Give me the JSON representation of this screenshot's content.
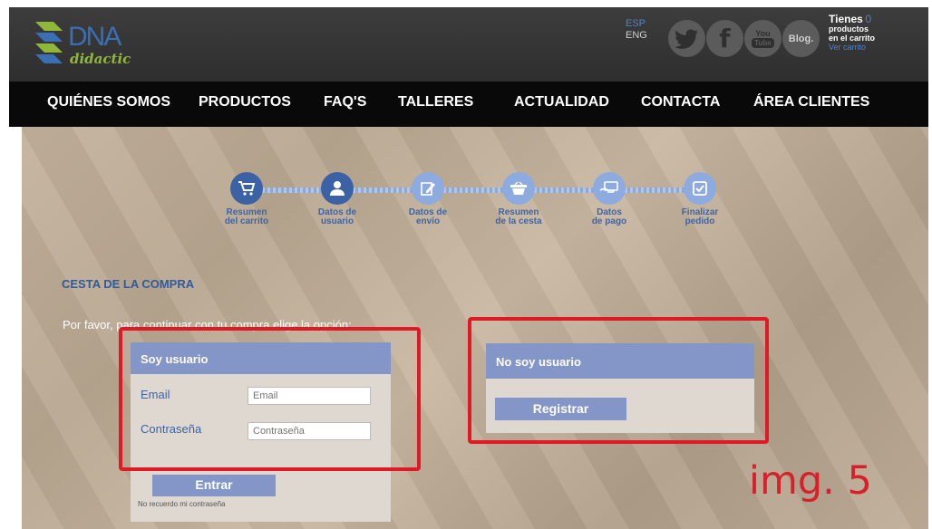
{
  "brand": {
    "name": "DNA",
    "sub": "didactic"
  },
  "languages": {
    "active": "ESP",
    "other": "ENG"
  },
  "social": {
    "twitter": "twitter-icon",
    "facebook": "f",
    "youtube_top": "You",
    "youtube_bottom": "Tube",
    "blog": "Blog."
  },
  "cart": {
    "heading": "Tienes",
    "count": "0",
    "line2": "productos",
    "line3": "en el carrito",
    "link": "Ver carrito"
  },
  "nav": [
    "QUIÉNES SOMOS",
    "PRODUCTOS",
    "FAQ'S",
    "TALLERES",
    "ACTUALIDAD",
    "CONTACTA",
    "ÁREA CLIENTES"
  ],
  "steps": [
    {
      "l1": "Resumen",
      "l2": "del carrito",
      "icon": "cart-icon",
      "state": "dark"
    },
    {
      "l1": "Datos de",
      "l2": "usuario",
      "icon": "user-icon",
      "state": "dark"
    },
    {
      "l1": "Datos de",
      "l2": "envío",
      "icon": "edit-icon",
      "state": "light"
    },
    {
      "l1": "Resumen",
      "l2": "de la cesta",
      "icon": "basket-icon",
      "state": "light"
    },
    {
      "l1": "Datos",
      "l2": "de pago",
      "icon": "card-hand-icon",
      "state": "light"
    },
    {
      "l1": "Finalizar",
      "l2": "pedido",
      "icon": "checkbox-icon",
      "state": "light"
    }
  ],
  "page": {
    "title": "CESTA DE LA COMPRA",
    "prompt": "Por favor, para continuar con tu compra elige la opción:"
  },
  "login": {
    "header": "Soy usuario",
    "email_label": "Email",
    "email_placeholder": "Email",
    "password_label": "Contraseña",
    "password_placeholder": "Contraseña",
    "submit": "Entrar",
    "forgot": "No recuerdo mi contraseña"
  },
  "register": {
    "header": "No soy usuario",
    "button": "Registrar"
  },
  "annotation": "img. 5",
  "colors": {
    "accent": "#8495c7",
    "highlight": "#e01a24",
    "nav_bg": "#090909",
    "step_active": "#3b62a5",
    "step_inactive": "#8eabe0"
  }
}
